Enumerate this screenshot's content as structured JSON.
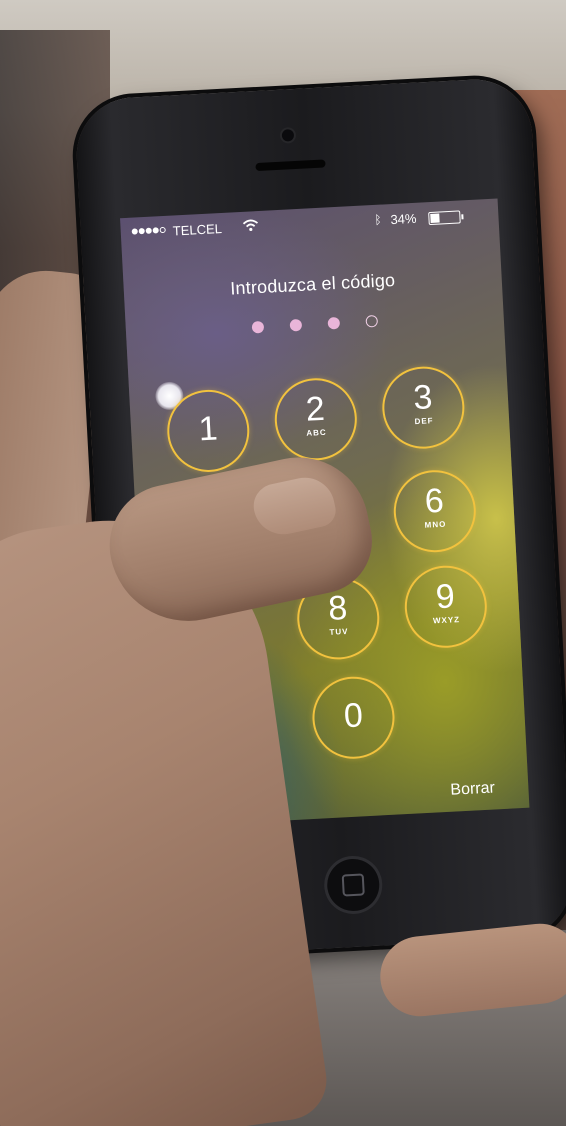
{
  "status_bar": {
    "carrier": "TELCEL",
    "battery_percent": "34%",
    "signal_icon": "signal-dots-icon",
    "wifi_icon": "wifi-icon",
    "bluetooth_icon": "bluetooth-icon",
    "battery_icon": "battery-icon",
    "battery_level": 0.34
  },
  "lock_screen": {
    "prompt": "Introduzca el código",
    "passcode_entered": 3,
    "passcode_length": 4,
    "delete_label": "Borrar",
    "keys": [
      {
        "digit": "1",
        "letters": ""
      },
      {
        "digit": "2",
        "letters": "ABC"
      },
      {
        "digit": "3",
        "letters": "DEF"
      },
      {
        "digit": "6",
        "letters": "MNO"
      },
      {
        "digit": "8",
        "letters": "TUV"
      },
      {
        "digit": "9",
        "letters": "WXYZ"
      },
      {
        "digit": "0",
        "letters": ""
      }
    ]
  },
  "colors": {
    "key_ring": "#f2c23e",
    "dot_filled": "#e9b5d9",
    "text": "#ffffff"
  }
}
